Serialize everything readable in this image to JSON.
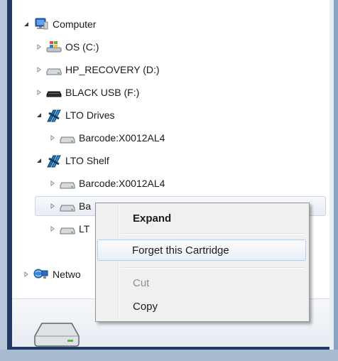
{
  "tree": {
    "items": [
      {
        "label": "Computer",
        "icon": "computer-icon",
        "expanded": true
      },
      {
        "label": "OS (C:)",
        "icon": "windows-drive-icon",
        "expanded": false
      },
      {
        "label": "HP_RECOVERY (D:)",
        "icon": "drive-icon",
        "expanded": false
      },
      {
        "label": "BLACK USB (F:)",
        "icon": "usb-drive-icon",
        "expanded": false
      },
      {
        "label": "LTO Drives",
        "icon": "lto-icon",
        "expanded": true
      },
      {
        "label": "Barcode:X0012AL4",
        "icon": "drive-icon",
        "expanded": false
      },
      {
        "label": "LTO Shelf",
        "icon": "lto-icon",
        "expanded": true
      },
      {
        "label": "Barcode:X0012AL4",
        "icon": "drive-icon",
        "expanded": false
      },
      {
        "label": "Ba",
        "icon": "drive-icon",
        "expanded": false
      },
      {
        "label": "LT",
        "icon": "drive-icon",
        "expanded": false
      },
      {
        "label": "Netwo",
        "icon": "network-icon",
        "expanded": false
      }
    ]
  },
  "context_menu": {
    "items": [
      {
        "label": "Expand",
        "bold": true,
        "enabled": true
      },
      {
        "label": "Forget this Cartridge",
        "bold": false,
        "enabled": true,
        "highlighted": true
      },
      {
        "label": "Cut",
        "bold": false,
        "enabled": false
      },
      {
        "label": "Copy",
        "bold": false,
        "enabled": true
      }
    ]
  },
  "details_pane": {
    "icon": "drive-icon"
  },
  "colors": {
    "frame_dark": "#1f3b63",
    "frame_light": "#b7c6d8",
    "menu_background": "#f0f0f0",
    "menu_highlight_border": "#aecff7",
    "disabled_text": "#8f8f8f"
  }
}
